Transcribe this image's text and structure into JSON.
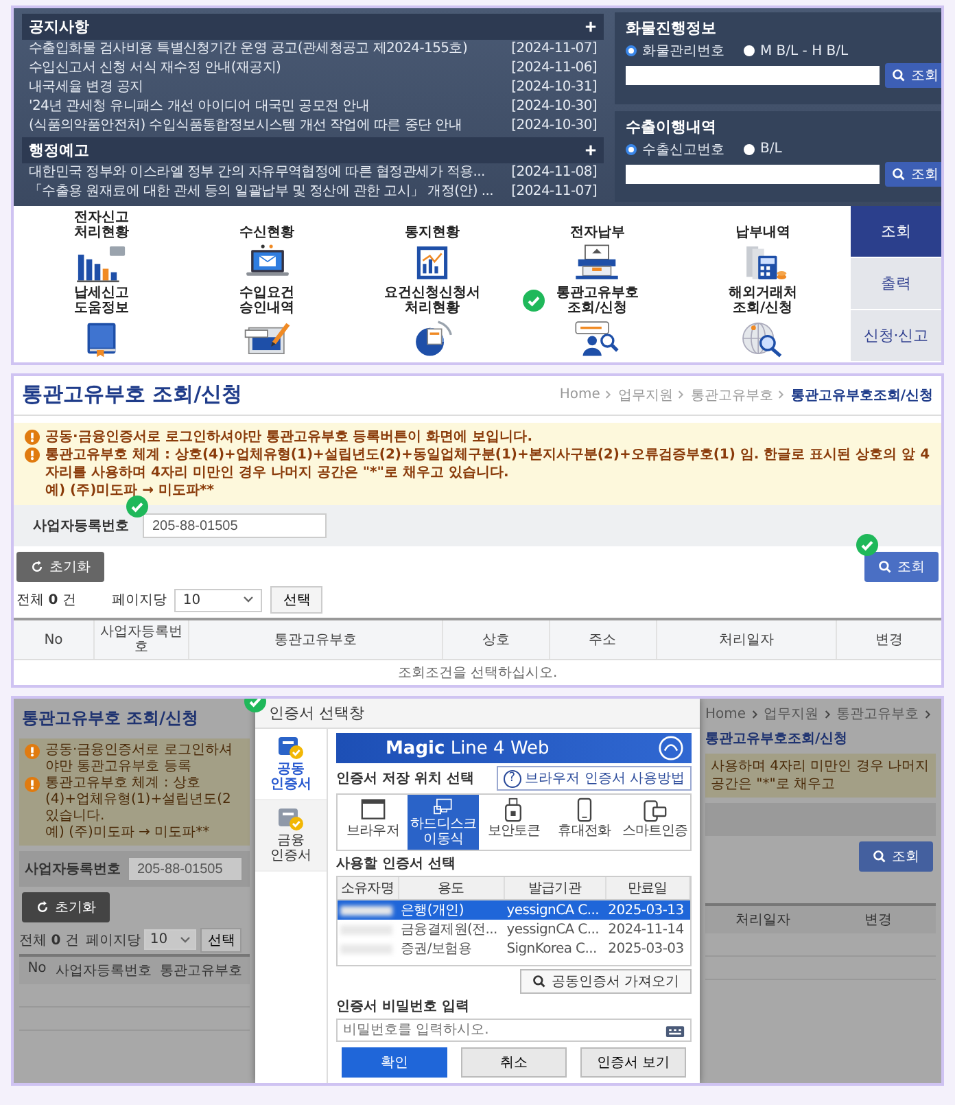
{
  "portal": {
    "notices": {
      "title": "공지사항",
      "items": [
        {
          "title": "수출입화물 검사비용 특별신청기간 운영 공고(관세청공고 제2024-155호)",
          "date": "[2024-11-07]"
        },
        {
          "title": "수입신고서 신청 서식 재수정 안내(재공지)",
          "date": "[2024-11-06]"
        },
        {
          "title": "내국세율 변경 공지",
          "date": "[2024-10-31]"
        },
        {
          "title": "'24년 관세청 유니패스 개선 아이디어 대국민 공모전 안내",
          "date": "[2024-10-30]"
        },
        {
          "title": "(식품의약품안전처) 수입식품통합정보시스템 개선 작업에 따른 중단 안내",
          "date": "[2024-10-30]"
        }
      ]
    },
    "admin_notices": {
      "title": "행정예고",
      "items": [
        {
          "title": "대한민국 정부와 이스라엘 정부 간의 자유무역협정에 따른 협정관세가 적용...",
          "date": "[2024-11-08]"
        },
        {
          "title": "「수출용 원재료에 대한 관세 등의 일괄납부 및 정산에 관한 고시」 개정(안) ...",
          "date": "[2024-11-07]"
        }
      ]
    },
    "searches": [
      {
        "title": "화물진행정보",
        "options": [
          {
            "label": "화물관리번호",
            "selected": true
          },
          {
            "label": "M B/L - H B/L",
            "selected": false
          }
        ],
        "button": "조회"
      },
      {
        "title": "수출이행내역",
        "options": [
          {
            "label": "수출신고번호",
            "selected": true
          },
          {
            "label": "B/L",
            "selected": false
          }
        ],
        "button": "조회"
      }
    ],
    "menu": [
      {
        "label": "전자신고\n처리현황",
        "check_mark": false
      },
      {
        "label": "수신현황",
        "check_mark": false
      },
      {
        "label": "통지현황",
        "check_mark": false
      },
      {
        "label": "전자납부",
        "check_mark": false
      },
      {
        "label": "납부내역",
        "check_mark": false
      },
      {
        "label": "납세신고\n도움정보",
        "check_mark": false
      },
      {
        "label": "수입요건\n승인내역",
        "check_mark": false
      },
      {
        "label": "요건신청신청서\n처리현황",
        "check_mark": false
      },
      {
        "label": "통관고유부호\n조회/신청",
        "check_mark": true
      },
      {
        "label": "해외거래처\n조회/신청",
        "check_mark": false
      }
    ],
    "side_tabs": [
      {
        "label": "조회",
        "selected": true
      },
      {
        "label": "출력",
        "selected": false
      },
      {
        "label": "신청·신고",
        "selected": false
      }
    ]
  },
  "lookup_page": {
    "title": "통관고유부호 조회/신청",
    "breadcrumb": [
      "Home",
      "업무지원",
      "통관고유부호",
      "통관고유부호조회/신청"
    ],
    "notices": [
      {
        "kind": "alert",
        "text": "공동·금융인증서로 로그인하셔야만 통관고유부호 등록버튼이 화면에 보입니다."
      },
      {
        "kind": "alert",
        "text": "통관고유부호 체계 : 상호(4)+업체유형(1)+설립년도(2)+동일업체구분(1)+본지사구분(2)+오류검증부호(1) 임. 한글로 표시된 상호의 앞 4자리를 사용하며 4자리 미만인 경우 나머지 공간은 \"*\"로 채우고 있습니다."
      },
      {
        "kind": "plain",
        "text": "예) (주)미도파 → 미도파**"
      }
    ],
    "search_label": "사업자등록번호",
    "search_value": "205-88-01505",
    "field_check_mark": true,
    "reset_button": "초기화",
    "search_button": "조회",
    "button_check_mark": true,
    "total": "전체 **0** 건",
    "per_page_label": "페이지당",
    "per_page": "10",
    "select_button": "선택",
    "columns": [
      "No",
      "사업자등록번호",
      "통관고유부호",
      "상호",
      "주소",
      "처리일자",
      "변경"
    ],
    "empty_message": "조회조건을 선택하십시오."
  },
  "cert_screen": {
    "background": {
      "title": "통관고유부호 조회/신청",
      "breadcrumb": [
        "Home",
        "업무지원",
        "통관고유부호",
        "통관고유부호조회/신청"
      ],
      "notices_left": [
        {
          "kind": "alert",
          "text": "공동·금융인증서로 로그인하셔야만 통관고유부호 등록"
        },
        {
          "kind": "alert",
          "text": "통관고유부호 체계 : 상호(4)+업체유형(1)+설립년도(2"
        },
        {
          "kind": "plain",
          "text": "있습니다."
        },
        {
          "kind": "plain",
          "text": "예) (주)미도파 → 미도파**"
        }
      ],
      "notice_right": "사용하며 4자리 미만인 경우 나머지 공간은 \"*\"로 채우고",
      "search_label": "사업자등록번호",
      "search_value": "205-88-01505",
      "reset_button": "초기화",
      "search_button": "조회",
      "total": "전체 **0** 건",
      "per_page_label": "페이지당",
      "per_page": "10",
      "select_button": "선택",
      "columns_left": [
        "No",
        "사업자등록번호",
        "통관고유부호"
      ],
      "columns_right": [
        "처리일자",
        "변경"
      ]
    },
    "dialog": {
      "title": "인증서 선택창",
      "check_mark": true,
      "cert_types": [
        {
          "label": "공동\n인증서",
          "selected": true
        },
        {
          "label": "금융\n인증서",
          "selected": false
        }
      ],
      "banner": "**Magic** Line 4 Web",
      "location_label": "인증서 저장 위치 선택",
      "help_mark": "?",
      "help_button": "브라우저 인증서 사용방법",
      "locations": [
        {
          "label": "브라우저",
          "selected": false
        },
        {
          "label": "하드디스크\n이동식",
          "selected": true
        },
        {
          "label": "보안토큰",
          "selected": false
        },
        {
          "label": "휴대전화",
          "selected": false
        },
        {
          "label": "스마트인증",
          "selected": false
        }
      ],
      "cert_label": "사용할 인증서 선택",
      "cert_columns": [
        "소유자명",
        "용도",
        "발급기관",
        "만료일"
      ],
      "certs": [
        {
          "usage": "은행(개인)",
          "issuer": "yessignCA C...",
          "expiry": "2025-03-13",
          "selected": true
        },
        {
          "usage": "금융결제원(전...",
          "issuer": "yessignCA C...",
          "expiry": "2024-11-14",
          "selected": false
        },
        {
          "usage": "증권/보험용",
          "issuer": "SignKorea C...",
          "expiry": "2025-03-03",
          "selected": false
        }
      ],
      "import_button": "공동인증서 가져오기",
      "password_label": "인증서 비밀번호 입력",
      "password_placeholder": "비밀번호를 입력하시오.",
      "buttons": [
        {
          "label": "확인",
          "kind": "primary"
        },
        {
          "label": "취소",
          "kind": "secondary"
        },
        {
          "label": "인증서 보기",
          "kind": "secondary"
        }
      ]
    }
  }
}
